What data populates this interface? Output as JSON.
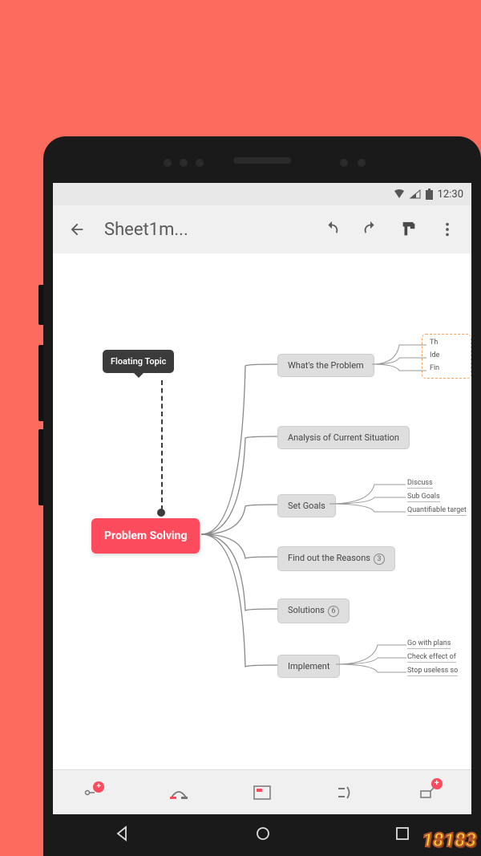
{
  "statusbar": {
    "time": "12:30"
  },
  "topbar": {
    "title": "Sheet1m..."
  },
  "mindmap": {
    "floating": "Floating Topic",
    "root": "Problem Solving",
    "branches": [
      {
        "label": "What's the Problem"
      },
      {
        "label": "Analysis of Current Situation"
      },
      {
        "label": "Set Goals"
      },
      {
        "label": "Find out the Reasons",
        "badge": "3"
      },
      {
        "label": "Solutions",
        "badge": "6"
      },
      {
        "label": "Implement"
      }
    ],
    "leaves_b1": [
      "Th",
      "Ide",
      "Fin"
    ],
    "leaves_b3": [
      "Discuss",
      "Sub Goals",
      "Quantifiable target"
    ],
    "leaves_b6": [
      "Go with plans",
      "Check effect of",
      "Stop useless so"
    ]
  },
  "watermark": "18183"
}
